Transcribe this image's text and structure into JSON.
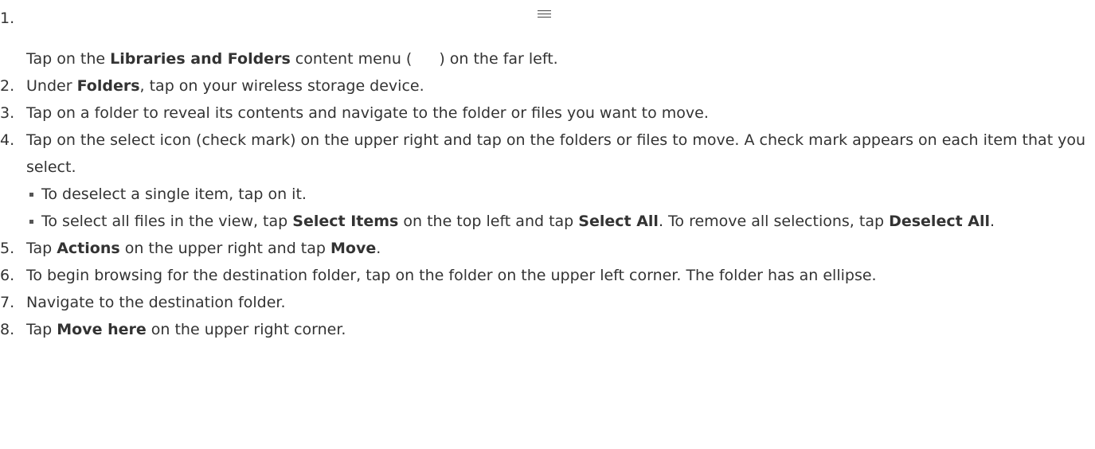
{
  "steps": [
    {
      "num": "1.",
      "parts": [
        "Tap on the ",
        "Libraries and Folders",
        " content menu (",
        ") on the far left."
      ]
    },
    {
      "num": "2.",
      "parts": [
        "Under ",
        "Folders",
        ", tap on your wireless storage device."
      ]
    },
    {
      "num": "3.",
      "text": "Tap on a folder to reveal its contents and navigate to the folder or files you want to move."
    },
    {
      "num": "4.",
      "text": "Tap on the select icon (check mark) on the upper right and tap on the folders or files to move. A check mark appears on each item that you select.",
      "bullets": [
        {
          "text": "To deselect a single item, tap on it."
        },
        {
          "parts": [
            "To select all files in the view, tap ",
            "Select Items",
            " on the top left and tap ",
            "Select All",
            ". To remove all selections, tap ",
            "Deselect All",
            "."
          ]
        }
      ]
    },
    {
      "num": "5.",
      "parts": [
        "Tap ",
        "Actions",
        " on the upper right and tap ",
        "Move",
        "."
      ]
    },
    {
      "num": "6.",
      "text": "To begin browsing for the destination folder, tap on the folder on the upper left corner. The folder has an ellipse."
    },
    {
      "num": "7.",
      "text": "Navigate to the destination folder."
    },
    {
      "num": "8.",
      "parts": [
        "Tap ",
        "Move here",
        " on the upper right corner."
      ]
    }
  ],
  "icons": {
    "menu": "hamburger-menu-icon"
  }
}
